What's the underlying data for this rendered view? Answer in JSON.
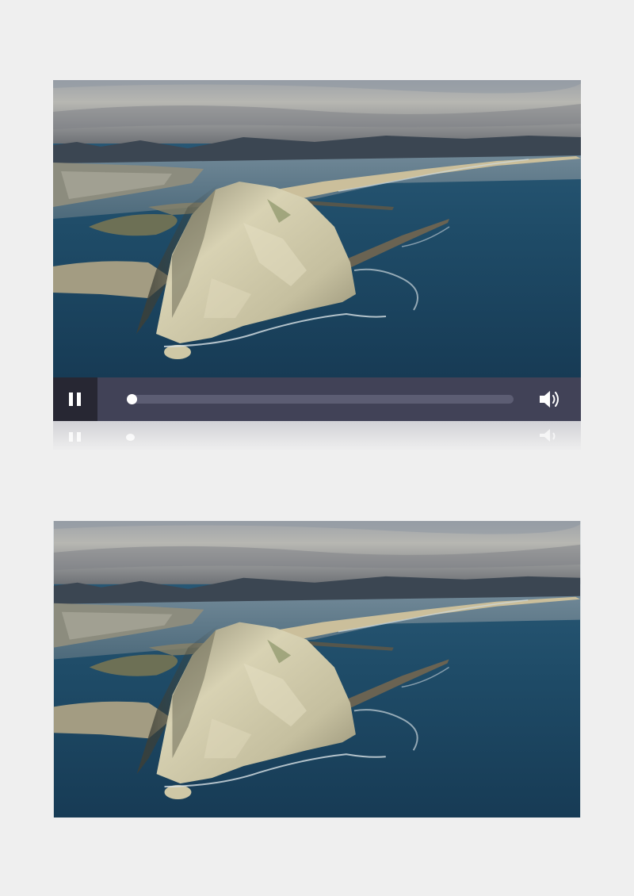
{
  "player_top": {
    "state": "playing",
    "progress": 0.0,
    "pause_icon": "pause-icon",
    "volume_icon": "volume-icon"
  },
  "player_bottom": {
    "state": "still-frame"
  },
  "colors": {
    "page_background": "#efefef",
    "control_bar": "#414257",
    "pause_button_bg": "#272733",
    "progress_track": "#5c5d73",
    "icon_color": "#ffffff"
  }
}
